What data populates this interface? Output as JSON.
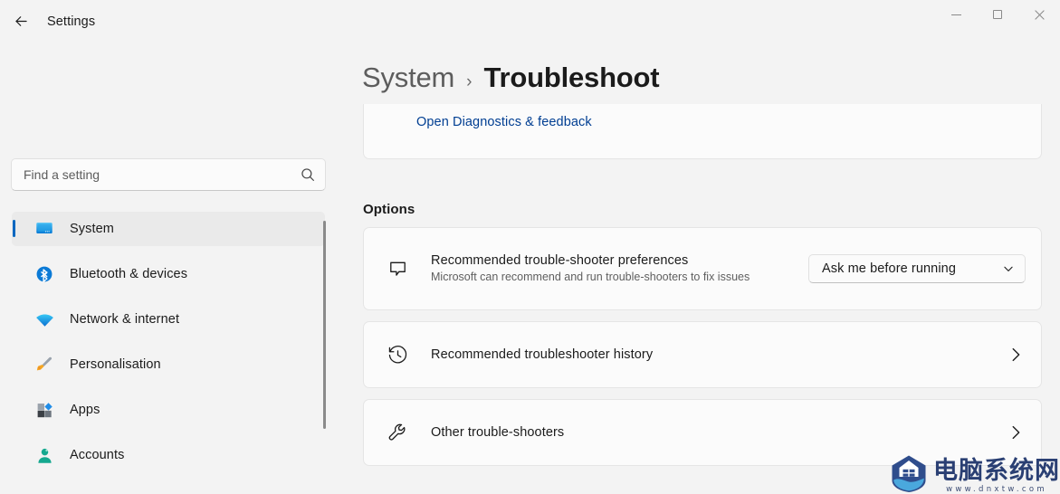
{
  "window": {
    "app_title": "Settings",
    "back_icon": "back-arrow-icon",
    "controls": {
      "minimize": "minimize-icon",
      "maximize": "maximize-icon",
      "close": "close-icon"
    }
  },
  "search": {
    "placeholder": "Find a setting",
    "value": "",
    "icon": "search-icon"
  },
  "sidebar": {
    "items": [
      {
        "label": "System",
        "icon": "monitor-icon",
        "selected": true
      },
      {
        "label": "Bluetooth & devices",
        "icon": "bluetooth-icon",
        "selected": false
      },
      {
        "label": "Network & internet",
        "icon": "wifi-icon",
        "selected": false
      },
      {
        "label": "Personalisation",
        "icon": "paintbrush-icon",
        "selected": false
      },
      {
        "label": "Apps",
        "icon": "apps-icon",
        "selected": false
      },
      {
        "label": "Accounts",
        "icon": "person-icon",
        "selected": false
      }
    ],
    "accent_color": "#0067c0"
  },
  "breadcrumb": {
    "root": "System",
    "separator": "›",
    "leaf": "Troubleshoot"
  },
  "main": {
    "top_card": {
      "link_label": "Open Diagnostics & feedback",
      "link_color": "#003e92"
    },
    "section_title": "Options",
    "cards": [
      {
        "icon": "speech-bubble-icon",
        "title": "Recommended trouble-shooter preferences",
        "subtitle": "Microsoft can recommend and run trouble-shooters to fix issues",
        "control": "combobox",
        "combo_value": "Ask me before running",
        "combo_icon": "chevron-down-icon"
      },
      {
        "icon": "history-icon",
        "title": "Recommended troubleshooter history",
        "subtitle": "",
        "control": "chevron",
        "chevron_icon": "chevron-right-icon"
      },
      {
        "icon": "wrench-icon",
        "title": "Other trouble-shooters",
        "subtitle": "",
        "control": "chevron",
        "chevron_icon": "chevron-right-icon"
      }
    ]
  },
  "watermark": {
    "logo_icon": "house-shield-logo-icon",
    "name": "电脑系统网",
    "url": "www.dnxtw.com"
  }
}
